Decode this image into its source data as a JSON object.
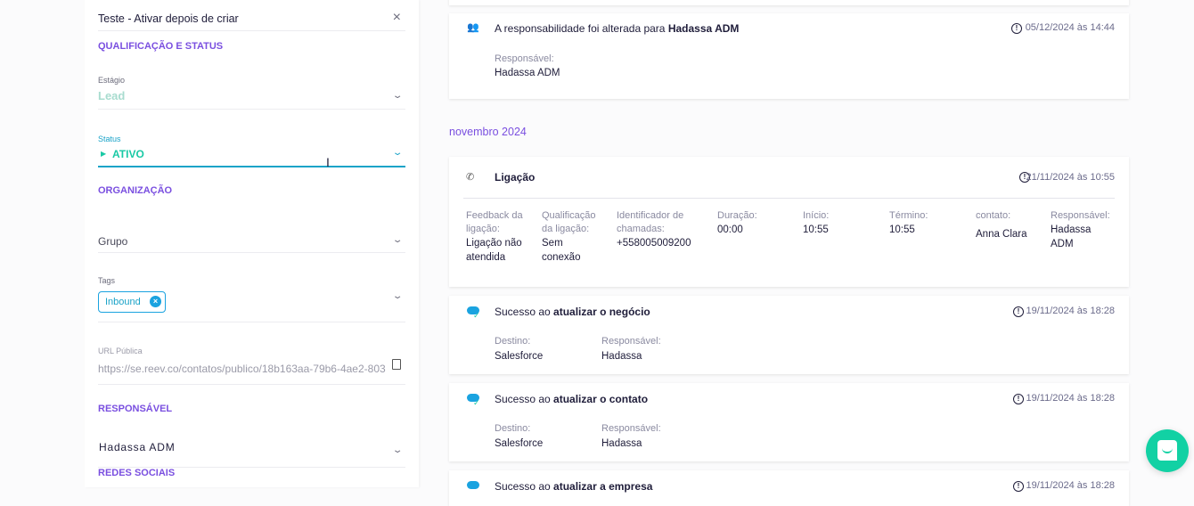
{
  "panel": {
    "header_title": "Teste - Ativar depois de criar",
    "sections": {
      "qualification": "QUALIFICAÇÃO E STATUS",
      "organization": "ORGANIZAÇÃO",
      "responsible": "RESPONSÁVEL",
      "social": "REDES SOCIAIS"
    },
    "stage": {
      "label": "Estágio",
      "value": "Lead"
    },
    "status": {
      "label": "Status",
      "value": "ATIVO"
    },
    "group": {
      "placeholder": "Grupo"
    },
    "tags": {
      "label": "Tags",
      "items": [
        "Inbound"
      ]
    },
    "public_url": {
      "label": "URL Pública",
      "value": "https://se.reev.co/contatos/publico/18b163aa-79b6-4ae2-803"
    },
    "responsible_value": "Hadassa ADM"
  },
  "timeline": {
    "resp_card": {
      "title_prefix": "A responsabilidade foi alterada para ",
      "title_bold": "Hadassa ADM",
      "date": "05/12/2024 às 14:44",
      "field_label": "Responsável:",
      "field_value": "Hadassa ADM"
    },
    "month": "novembro 2024",
    "call_card": {
      "title": "Ligação",
      "date": "21/11/2024 às 10:55",
      "fields": [
        {
          "label": "Feedback da ligação:",
          "value": "Ligação não atendida"
        },
        {
          "label": "Qualificação da ligação:",
          "value": "Sem conexão"
        },
        {
          "label": "Identificador de chamadas:",
          "value": "+558005009200"
        },
        {
          "label": "Duração:",
          "value": "00:00"
        },
        {
          "label": "Início:",
          "value": "10:55"
        },
        {
          "label": "Término:",
          "value": "10:55"
        },
        {
          "label": "contato:",
          "value": "Anna Clara"
        },
        {
          "label": "Responsável:",
          "value": "Hadassa ADM"
        }
      ]
    },
    "sync_cards": [
      {
        "prefix": "Sucesso ao ",
        "bold": "atualizar o negócio",
        "date": "19/11/2024 às 18:28",
        "dest_label": "Destino:",
        "dest": "Salesforce",
        "resp_label": "Responsável:",
        "resp": "Hadassa"
      },
      {
        "prefix": "Sucesso ao ",
        "bold": "atualizar o contato",
        "date": "19/11/2024 às 18:28",
        "dest_label": "Destino:",
        "dest": "Salesforce",
        "resp_label": "Responsável:",
        "resp": "Hadassa"
      },
      {
        "prefix": "Sucesso ao ",
        "bold": "atualizar a empresa",
        "date": "19/11/2024 às 18:28"
      }
    ]
  }
}
